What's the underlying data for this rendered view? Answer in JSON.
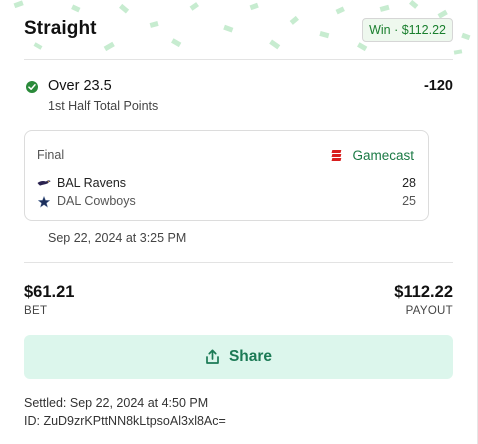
{
  "header": {
    "title": "Straight",
    "badge": "Win · $112.22"
  },
  "selection": {
    "name": "Over 23.5",
    "market": "1st Half Total Points",
    "odds": "-120",
    "status_icon": "check-circle-icon"
  },
  "game": {
    "status": "Final",
    "gamecast_label": "Gamecast",
    "teams": [
      {
        "name": "BAL Ravens",
        "score": "28",
        "logo": "ravens-logo-icon"
      },
      {
        "name": "DAL Cowboys",
        "score": "25",
        "logo": "cowboys-star-icon"
      }
    ],
    "datetime": "Sep 22, 2024 at 3:25 PM"
  },
  "amounts": {
    "bet_value": "$61.21",
    "bet_label": "BET",
    "payout_value": "$112.22",
    "payout_label": "PAYOUT"
  },
  "share": {
    "label": "Share"
  },
  "footer": {
    "settled": "Settled: Sep 22, 2024 at 4:50 PM",
    "id": "ID: ZuD9zrKPttNN8kLtpsoAl3xl8Ac="
  },
  "colors": {
    "accent_green": "#1b7a45",
    "win_badge_bg": "#eef8ee",
    "share_bg": "#dcf6ec",
    "confetti": "#bfe9c8"
  }
}
